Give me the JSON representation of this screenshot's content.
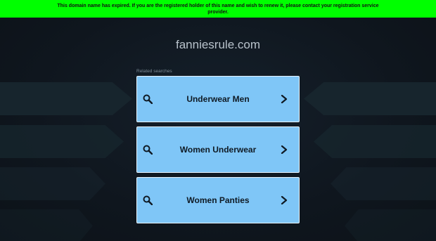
{
  "banner": {
    "message": "This domain name has expired. If you are the registered holder of this name and wish to renew it, please contact your registration service provider."
  },
  "domain": {
    "name": "fanniesrule.com"
  },
  "related": {
    "label": "Related searches",
    "items": [
      {
        "label": "Underwear Men"
      },
      {
        "label": "Women Underwear"
      },
      {
        "label": "Women Panties"
      }
    ]
  },
  "colors": {
    "banner_bg": "#00ff00",
    "page_bg": "#101720",
    "button_bg": "#7fc6f7",
    "button_border": "#e8f4ff",
    "text_dark": "#0f1a24"
  },
  "icons": {
    "search": "search-icon",
    "chevron": "chevron-right-icon"
  }
}
